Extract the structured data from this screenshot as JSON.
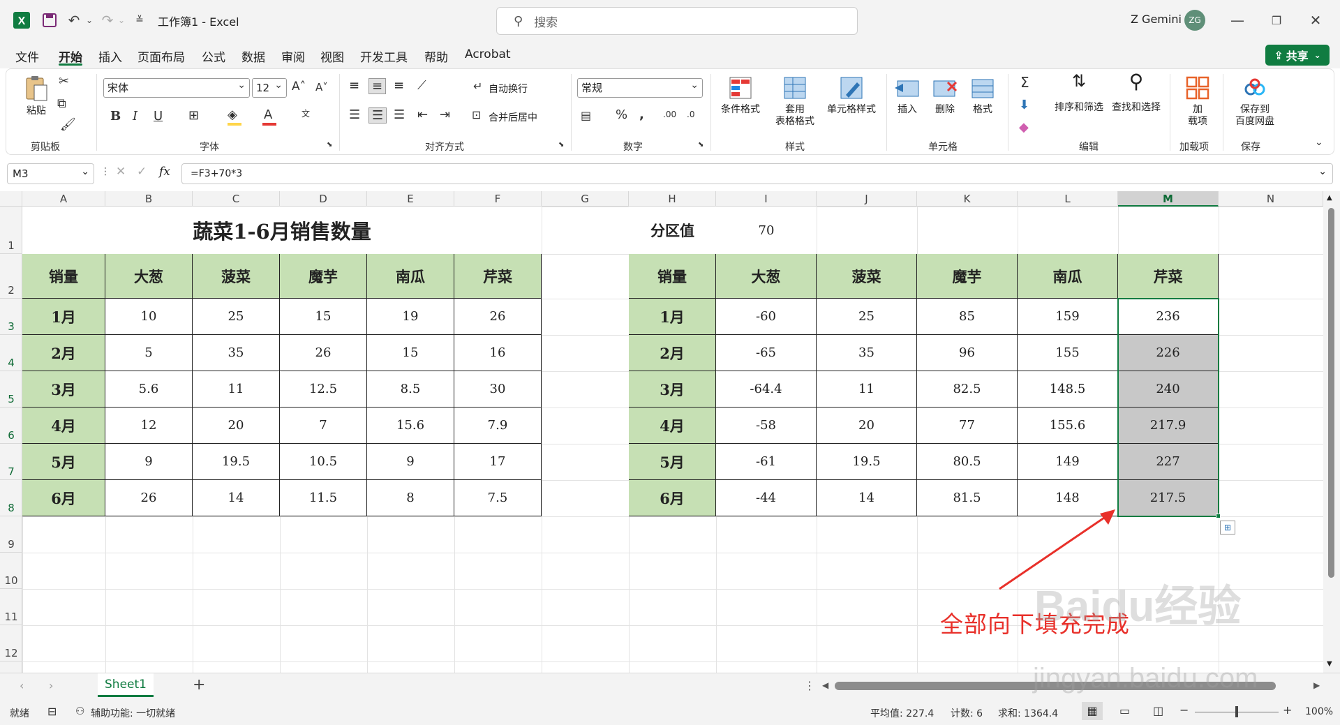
{
  "titlebar": {
    "doc_title": "工作簿1 - Excel",
    "search_placeholder": "搜索",
    "user_name": "Z Gemini",
    "avatar_initials": "ZG"
  },
  "menu": {
    "items": [
      "文件",
      "开始",
      "插入",
      "页面布局",
      "公式",
      "数据",
      "审阅",
      "视图",
      "开发工具",
      "帮助",
      "Acrobat"
    ],
    "active": "开始",
    "share_label": "共享"
  },
  "ribbon": {
    "clipboard": {
      "paste": "粘贴",
      "label": "剪贴板"
    },
    "font": {
      "family": "宋体",
      "size": "12",
      "label": "字体"
    },
    "align": {
      "wrap": "自动换行",
      "merge": "合并后居中",
      "label": "对齐方式"
    },
    "number": {
      "format": "常规",
      "label": "数字"
    },
    "styles": {
      "cond": "条件格式",
      "table1": "套用",
      "table2": "表格格式",
      "cell": "单元格样式",
      "label": "样式"
    },
    "cells": {
      "insert": "插入",
      "delete": "删除",
      "format": "格式",
      "label": "单元格"
    },
    "edit": {
      "sort": "排序和筛选",
      "find": "查找和选择",
      "label": "编辑"
    },
    "addins": {
      "btn1": "加",
      "btn2": "载项",
      "label": "加载项"
    },
    "save": {
      "btn1": "保存到",
      "btn2": "百度网盘",
      "label": "保存"
    }
  },
  "formula": {
    "namebox": "M3",
    "fx": "fx",
    "content": "=F3+70*3"
  },
  "columns": [
    "A",
    "B",
    "C",
    "D",
    "E",
    "F",
    "G",
    "H",
    "I",
    "J",
    "K",
    "L",
    "M",
    "N"
  ],
  "rows": [
    "1",
    "2",
    "3",
    "4",
    "5",
    "6",
    "7",
    "8",
    "9",
    "10",
    "11",
    "12"
  ],
  "table1": {
    "title": "蔬菜1-6月销售数量",
    "headers": [
      "销量",
      "大葱",
      "菠菜",
      "魔芋",
      "南瓜",
      "芹菜"
    ],
    "rows": [
      [
        "1月",
        "10",
        "25",
        "15",
        "19",
        "26"
      ],
      [
        "2月",
        "5",
        "35",
        "26",
        "15",
        "16"
      ],
      [
        "3月",
        "5.6",
        "11",
        "12.5",
        "8.5",
        "30"
      ],
      [
        "4月",
        "12",
        "20",
        "7",
        "15.6",
        "7.9"
      ],
      [
        "5月",
        "9",
        "19.5",
        "10.5",
        "9",
        "17"
      ],
      [
        "6月",
        "26",
        "14",
        "11.5",
        "8",
        "7.5"
      ]
    ]
  },
  "partition": {
    "label": "分区值",
    "value": "70"
  },
  "table2": {
    "headers": [
      "销量",
      "大葱",
      "菠菜",
      "魔芋",
      "南瓜",
      "芹菜"
    ],
    "rows": [
      [
        "1月",
        "-60",
        "25",
        "85",
        "159",
        "236"
      ],
      [
        "2月",
        "-65",
        "35",
        "96",
        "155",
        "226"
      ],
      [
        "3月",
        "-64.4",
        "11",
        "82.5",
        "148.5",
        "240"
      ],
      [
        "4月",
        "-58",
        "20",
        "77",
        "155.6",
        "217.9"
      ],
      [
        "5月",
        "-61",
        "19.5",
        "80.5",
        "149",
        "227"
      ],
      [
        "6月",
        "-44",
        "14",
        "81.5",
        "148",
        "217.5"
      ]
    ]
  },
  "sheet": {
    "tab": "Sheet1"
  },
  "status": {
    "ready": "就绪",
    "accessibility": "辅助功能: 一切就绪",
    "average": "平均值: 227.4",
    "count": "计数: 6",
    "sum": "求和: 1364.4",
    "zoom": "100%"
  },
  "annotation": "全部向下填充完成",
  "watermark": {
    "logo": "Baidu经验",
    "url": "jingyan.baidu.com"
  },
  "colors": {
    "excel_green": "#107c41",
    "header_fill": "#c6e0b4",
    "annotation": "#e8302a"
  }
}
